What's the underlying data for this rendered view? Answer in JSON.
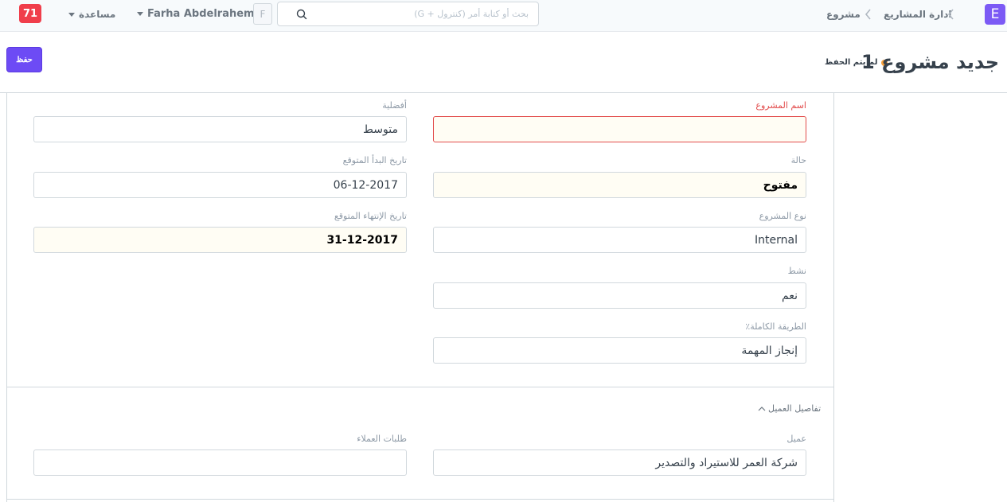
{
  "navbar": {
    "notification_count": "71",
    "help_label": "مساعدة",
    "user_name": "Farha Abdelrahem",
    "user_initial": "F",
    "search_placeholder": "بحث أو كتابة أمر (كنترول + G)",
    "breadcrumb": [
      "ادارة المشاريع",
      "مشروع"
    ],
    "logo_letter": "E"
  },
  "page": {
    "title": "جديد مشروع 1",
    "status": "لم يتم الحفظ",
    "save_label": "حفظ"
  },
  "form": {
    "project_name_label": "اسم المشروع",
    "project_name_value": "",
    "priority_label": "أفضلية",
    "priority_value": "متوسط",
    "status_label": "حالة",
    "status_value": "مفتوح",
    "expected_start_label": "تاريخ البدأ المتوقع",
    "expected_start_value": "06-12-2017",
    "project_type_label": "نوع المشروع",
    "project_type_value": "Internal",
    "expected_end_label": "تاريخ الإنتهاء المتوقع",
    "expected_end_value": "31-12-2017",
    "active_label": "نشط",
    "active_value": "نعم",
    "completion_method_label": "الطريقة الكاملة٪",
    "completion_method_value": "إنجاز المهمة",
    "customer_section_title": "تفاصيل العميل",
    "customer_label": "عميل",
    "customer_value": "شركة العمر للاستيراد والتصدير",
    "sales_order_label": "طلبات العملاء",
    "sales_order_value": ""
  },
  "colors": {
    "accent": "#6d4bf5",
    "notification": "#f03e4b",
    "unsaved_dot": "#f8a03a",
    "required_label": "#e24c4c"
  }
}
